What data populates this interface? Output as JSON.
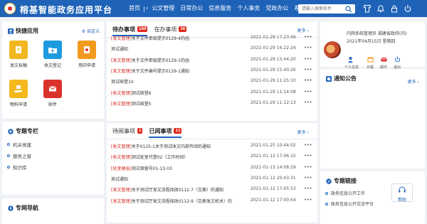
{
  "header": {
    "title": "榕基智能政务应用平台",
    "nav": [
      "首页",
      "公文管理",
      "日常办公",
      "信息服务",
      "个人事务",
      "党政办公",
      "系"
    ],
    "search_placeholder": "请输入搜索条件",
    "accent": "#1f63b8"
  },
  "quick_apps": {
    "title": "快捷应用",
    "customize": "自定义",
    "items": [
      {
        "label": "发文拟稿",
        "color": "#f2b61f",
        "icon": "document-icon"
      },
      {
        "label": "收文登记",
        "color": "#1e9be0",
        "icon": "folder-upload-icon"
      },
      {
        "label": "用印申请",
        "color": "#f29a1f",
        "icon": "stamp-document-icon"
      },
      {
        "label": "物料申请",
        "color": "#f4b81c",
        "icon": "hand-box-icon"
      },
      {
        "label": "邮件",
        "color": "#d9322b",
        "icon": "mail-icon"
      }
    ]
  },
  "topics": {
    "title": "专题专栏",
    "items": [
      "机关党建",
      "服务之窗",
      "知识库"
    ]
  },
  "site_nav": {
    "title": "专网导航"
  },
  "todo_panel": {
    "tab1": "待办事项",
    "tab1_count": "100",
    "tab2": "在办事项",
    "tab2_count": "36",
    "more": "更多",
    "rows": [
      {
        "tag": "[发文管理]",
        "subject": "关于文件密级提示0129-4的函",
        "time": "2021-01-29 17:23:49"
      },
      {
        "tag": "",
        "subject": "测试通知",
        "time": "2021-01-29 16:22:24"
      },
      {
        "tag": "[发文管理]",
        "subject": "关于文件密级提示0129-1的函",
        "time": "2021-01-29 15:44:20"
      },
      {
        "tag": "[发文管理]",
        "subject": "关于文件编号提示0129-1通知",
        "time": "2021-01-29 15:40:26"
      },
      {
        "tag": "",
        "subject": "测试续登10",
        "time": "2021-01-29 11:25:10"
      },
      {
        "tag": "[收文管理]",
        "subject": "测试续登6",
        "time": "2021-01-29 11:14:08"
      },
      {
        "tag": "[收文管理]",
        "subject": "测试续登5",
        "time": "2021-01-29 11:12:13"
      }
    ]
  },
  "done_panel": {
    "tab1": "待阅事项",
    "tab1_count": "1",
    "tab2": "已阅事项",
    "tab2_count": "11",
    "more": "更多",
    "rows": [
      {
        "tag": "[收文管理]",
        "subject": "关于0125-1关于测试收文内部传阅的通知",
        "time": "2021-01-25 10:44:02"
      },
      {
        "tag": "[收文管理]",
        "subject": "测试处室代登02（工作时间）",
        "time": "2021-01-13 17:06:15"
      },
      {
        "tag": "[处室便函]",
        "subject": "测试保留号01-13-03",
        "time": "2021-01-13 14:08:29"
      },
      {
        "tag": "",
        "subject": "测试通知",
        "time": "2021-01-12 20:43:31"
      },
      {
        "tag": "[发文管理]",
        "subject": "关于测试厅发文流程阅改0112-7（交换）的通知",
        "time": "2021-01-12 17:05:53"
      },
      {
        "tag": "[发文管理]",
        "subject": "关于测试厅发文流程阅改0112-9（交换发文机关）的",
        "time": "2021-01-12 17:00:54"
      }
    ]
  },
  "profile": {
    "line1": "内网系统管理员  福建省政府(内)",
    "date": "2021年04月15日",
    "weekday": "星期四",
    "actions": [
      "个人信息",
      "日程",
      "邮件",
      "退出"
    ]
  },
  "notice": {
    "title": "通知公告",
    "more": "更多"
  },
  "links": {
    "title": "专题链接",
    "items": [
      "政务信息公开工作",
      "政务信息公开交流平台"
    ]
  },
  "helper": {
    "label": "帮助"
  }
}
